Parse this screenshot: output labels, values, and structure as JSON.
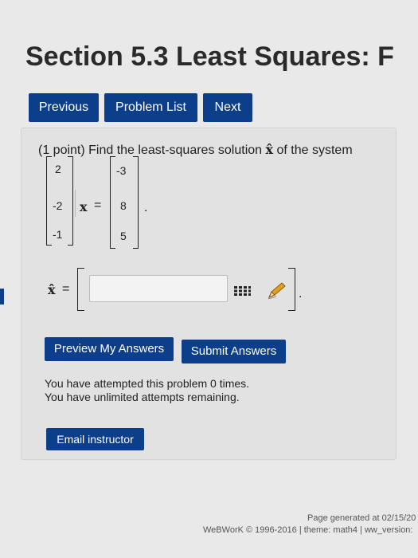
{
  "page": {
    "title": "Section 5.3 Least Squares: F"
  },
  "nav": {
    "previous": "Previous",
    "problem_list": "Problem List",
    "next": "Next"
  },
  "problem": {
    "intro": "(1 point) Find the least-squares solution",
    "xhat": "x̂",
    "outro": "of the system",
    "matrix_a": [
      "2",
      "-2",
      "-1"
    ],
    "x_symbol": "x",
    "equals": "=",
    "vector_b": [
      "-3",
      "8",
      "5"
    ],
    "period": "."
  },
  "answer": {
    "label": "x̂",
    "equals": "=",
    "value": "",
    "placeholder": "",
    "period": "."
  },
  "actions": {
    "preview": "Preview My Answers",
    "submit": "Submit Answers"
  },
  "status": {
    "attempts": "You have attempted this problem 0 times.",
    "remaining": "You have unlimited attempts remaining."
  },
  "email": {
    "label": "Email instructor"
  },
  "footer": {
    "generated": "Page generated at 02/15/20",
    "copyright": "WeBWorK © 1996-2016 | theme: math4 | ww_version:"
  },
  "colors": {
    "button_bg": "#0d3e8a",
    "page_bg": "#e9e9e9",
    "panel_bg": "#e2e2e2"
  }
}
